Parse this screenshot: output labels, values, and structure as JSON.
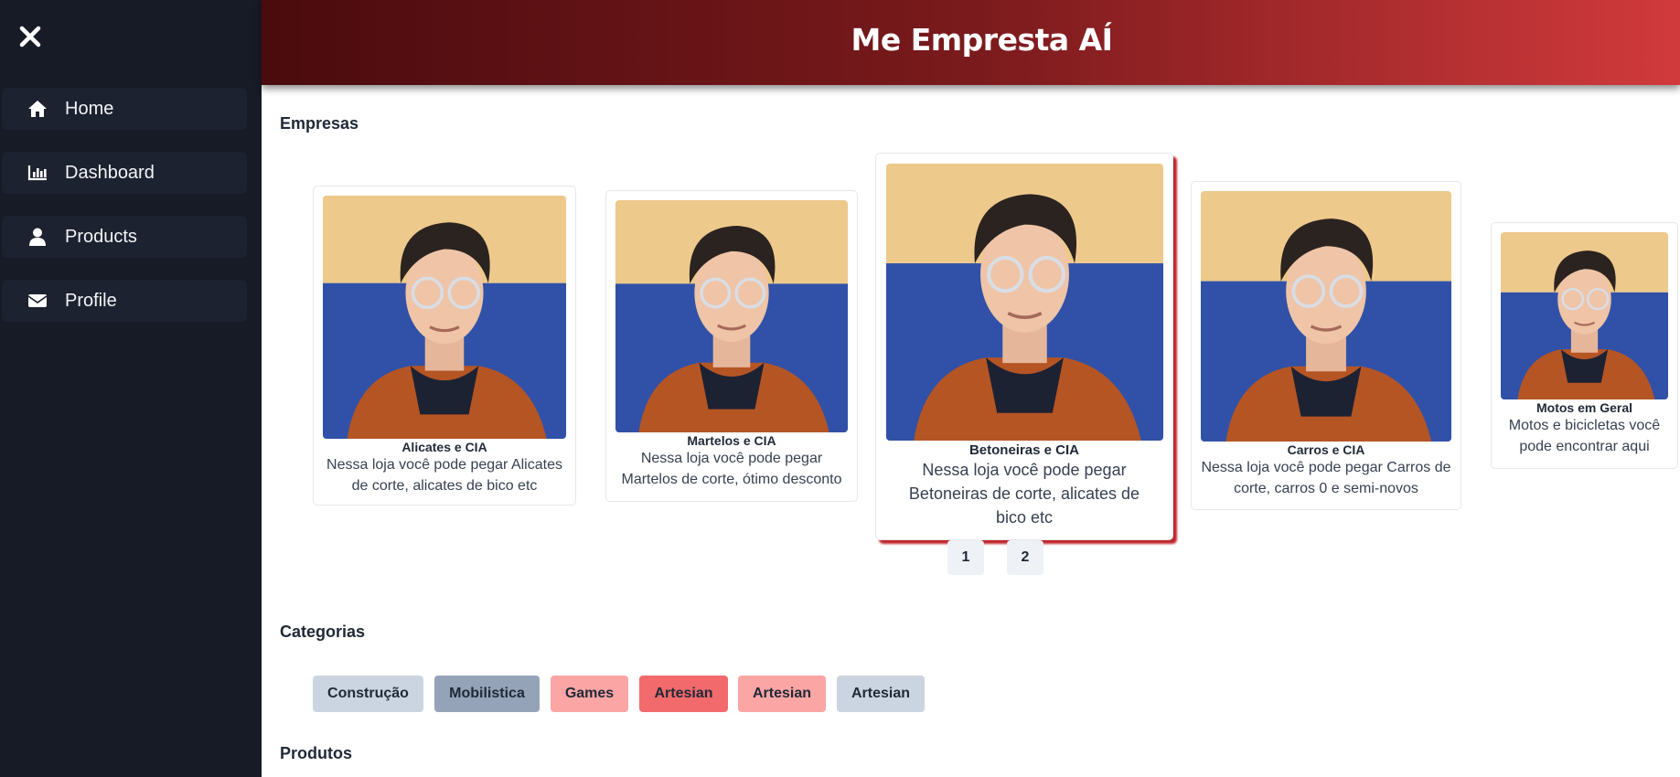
{
  "app": {
    "title": "Me Empresta AÍ"
  },
  "sidebar": {
    "close_icon": "close-icon",
    "items": [
      {
        "label": "Home",
        "icon": "home-icon"
      },
      {
        "label": "Dashboard",
        "icon": "chart-icon"
      },
      {
        "label": "Products",
        "icon": "user-icon"
      },
      {
        "label": "Profile",
        "icon": "envelope-icon"
      }
    ]
  },
  "sections": {
    "empresas": "Empresas",
    "categorias": "Categorias",
    "produtos": "Produtos"
  },
  "companies": [
    {
      "title": "Alicates e CIA",
      "description": "Nessa loja você pode pegar Alicates de corte, alicates de bico etc"
    },
    {
      "title": "Martelos e CIA",
      "description": "Nessa loja você pode pegar Martelos de corte, ótimo desconto"
    },
    {
      "title": "Betoneiras e CIA",
      "description": "Nessa loja você pode pegar Betoneiras de corte, alicates de bico etc"
    },
    {
      "title": "Carros e CIA",
      "description": "Nessa loja você pode pegar Carros de corte, carros 0 e semi-novos"
    },
    {
      "title": "Motos em Geral",
      "description": "Motos e bicicletas você pode encontrar aqui"
    }
  ],
  "pagination": {
    "pages": [
      "1",
      "2"
    ]
  },
  "categories": [
    {
      "label": "Construção",
      "color": "#cbd5e1"
    },
    {
      "label": "Mobilistica",
      "color": "#94a3b8"
    },
    {
      "label": "Games",
      "color": "#fca5a5"
    },
    {
      "label": "Artesian",
      "color": "#f26a6c"
    },
    {
      "label": "Artesian",
      "color": "#fca5a5"
    },
    {
      "label": "Artesian",
      "color": "#cbd5e1"
    }
  ],
  "colors": {
    "sidebar_bg": "#171b26",
    "nav_item_bg": "#1c2230",
    "header_gradient_start": "#4a0b0e",
    "header_gradient_end": "#d13a3c",
    "active_card_shadow": "#c0262d"
  }
}
